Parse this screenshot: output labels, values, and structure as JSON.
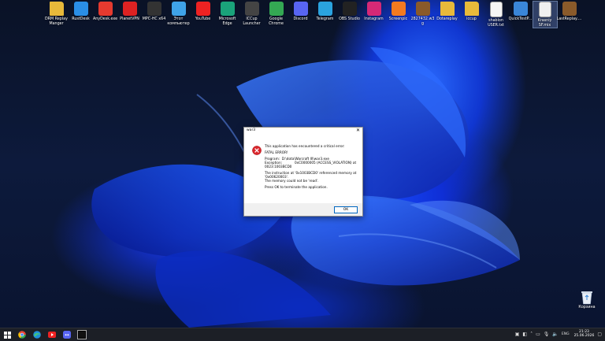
{
  "desktop": {
    "icons": [
      {
        "label": "DRM Replay Manger",
        "icon": "folder-icon",
        "color": "#e8b93a"
      },
      {
        "label": "RustDesk",
        "icon": "rustdesk-icon",
        "color": "#2a8ee6"
      },
      {
        "label": "AnyDesk.exe",
        "icon": "anydesk-icon",
        "color": "#e53a2f"
      },
      {
        "label": "PlanetVPN",
        "icon": "planetvpn-icon",
        "color": "#d22"
      },
      {
        "label": "MPC-HC x64",
        "icon": "mpc-icon",
        "color": "#333"
      },
      {
        "label": "Этот компьютер",
        "icon": "computer-icon",
        "color": "#3fa3e8"
      },
      {
        "label": "YouTube",
        "icon": "youtube-icon",
        "color": "#e22"
      },
      {
        "label": "Microsoft Edge",
        "icon": "edge-icon",
        "color": "#1aa37a"
      },
      {
        "label": "ICCup Launcher",
        "icon": "iccup-icon",
        "color": "#444"
      },
      {
        "label": "Google Chrome",
        "icon": "chrome-icon",
        "color": "#34a853"
      },
      {
        "label": "Discord",
        "icon": "discord-icon",
        "color": "#5865f2"
      },
      {
        "label": "Telegram",
        "icon": "telegram-icon",
        "color": "#2aa3df"
      },
      {
        "label": "OBS Studio",
        "icon": "obs-icon",
        "color": "#222"
      },
      {
        "label": "Instagram",
        "icon": "instagram-icon",
        "color": "#d62976"
      },
      {
        "label": "Screenpic",
        "icon": "screenpic-icon",
        "color": "#f47a20"
      },
      {
        "label": "2827432.w3g",
        "icon": "w3g-icon",
        "color": "#8a5a2a"
      },
      {
        "label": "Dotareplay",
        "icon": "folder-icon",
        "color": "#e8b93a"
      },
      {
        "label": "iccup",
        "icon": "folder-icon",
        "color": "#e8b93a"
      },
      {
        "label": "shablon USER.txt",
        "icon": "text-file-icon",
        "color": "#f5f5f5"
      },
      {
        "label": "QuickTestP...",
        "icon": "quicktest-icon",
        "color": "#3a86d8"
      },
      {
        "label": "Krasniy SF.mix",
        "icon": "file-icon",
        "color": "#f0f0f0"
      },
      {
        "label": "LastReplay....",
        "icon": "w3g-icon",
        "color": "#8a5a2a"
      }
    ],
    "recycle_bin": {
      "label": "Корзина",
      "icon": "recycle-bin-icon"
    }
  },
  "dialog": {
    "title": "war3",
    "close": "✕",
    "lines": [
      "This application has encountered a critical error:",
      "",
      "FATAL ERROR!",
      "",
      "Program:  D:\\dota\\Warcraft III\\war3.exe",
      "Exception:            0xC0000005 (ACCESS_VIOLATION) at",
      "0023:1003BCD0",
      "",
      "The instruction at '0x1003BCD0' referenced memory at",
      "'0x00620003'.",
      "The memory could not be 'read'.",
      "",
      "Press OK to terminate the application."
    ],
    "ok_label": "OK"
  },
  "taskbar": {
    "apps": [
      "windows-start-icon",
      "chrome-icon",
      "edge-icon",
      "youtube-icon",
      "discord-icon",
      "warcraft-icon"
    ],
    "tray": {
      "lang": "ENG",
      "time": "21:23",
      "date": "25.06.2026"
    }
  }
}
